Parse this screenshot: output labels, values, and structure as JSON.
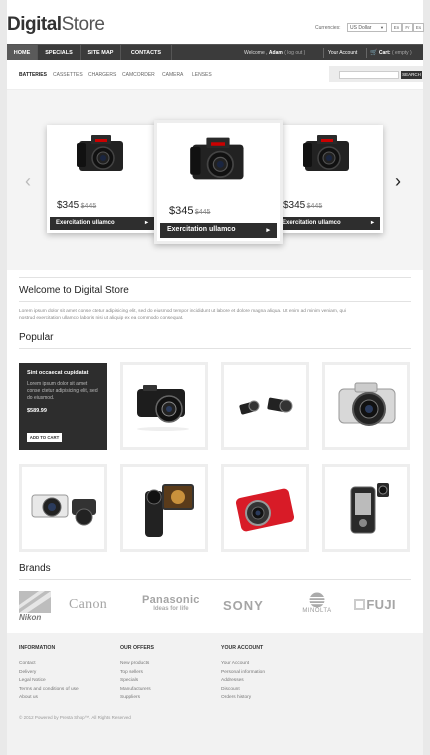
{
  "logo": {
    "bold": "Digital",
    "light": "Store"
  },
  "currency": {
    "label": "Currencies:",
    "selected": "US Dollar"
  },
  "languages": [
    "En",
    "Fr",
    "Es"
  ],
  "nav": {
    "items": [
      "HOME",
      "SPECIALS",
      "SITE MAP",
      "CONTACTS"
    ],
    "welcome_prefix": "Welcome ,",
    "user": "Adam",
    "logout": "( log out )",
    "account": "Your Account",
    "cart": "Cart:",
    "cart_status": "( empty )"
  },
  "categories": [
    "BATTERIES",
    "CASSETTES",
    "CHARGERS",
    "CAMCORDER",
    "CAMERA",
    "LENSES"
  ],
  "search": {
    "button": "SEARCH"
  },
  "slider": {
    "cards": [
      {
        "price": "$345",
        "old_price": "$445",
        "caption": "Exercitation ullamco"
      },
      {
        "price": "$345",
        "old_price": "$445",
        "caption": "Exercitation ullamco"
      },
      {
        "price": "$345",
        "old_price": "$445",
        "caption": "Exercitation ullamco"
      }
    ]
  },
  "welcome": {
    "title": "Welcome to Digital Store",
    "line1": "Lorem ipsum dolor sit amet conse ctetur adipisicing elit, sed do eiusmod tempor incididunt ut labore et dolore magna aliqua. Ut enim ad minim veniam, qui",
    "line2": "nostrud exercitation ullamco laboris nisi ut aliquip ex ea commodo consequat."
  },
  "popular": {
    "title": "Popular",
    "promo": {
      "title": "Sint occaecat cupidatat",
      "text": "Lorem ipsum dolor sit amet conse ctetur adipisicing elit, sed do eiusmod.",
      "price": "$589.99",
      "button": "ADD TO CART"
    }
  },
  "brands": {
    "title": "Brands",
    "items": [
      "Nikon",
      "Canon",
      "Panasonic",
      "Ideas for life",
      "SONY",
      "MINOLTA",
      "FUJI"
    ]
  },
  "footer": {
    "columns": [
      {
        "title": "INFORMATION",
        "links": [
          "Contact",
          "Delivery",
          "Legal Notice",
          "Terms and conditions of use",
          "About us"
        ]
      },
      {
        "title": "OUR OFFERS",
        "links": [
          "New products",
          "Top sellers",
          "Specials",
          "Manufacturers",
          "Suppliers"
        ]
      },
      {
        "title": "YOUR ACCOUNT",
        "links": [
          "Your Account",
          "Personal information",
          "Addresses",
          "Discount",
          "Orders history"
        ]
      }
    ],
    "copyright": "© 2012 Powered by Presta Shop™. All Rights Reserved"
  },
  "colors": {
    "nav_bg": "#3b3b3b",
    "caption_bg": "#2e2e2e",
    "promo_bg": "#2d2d2d",
    "cart_red": "#e82b2b"
  }
}
